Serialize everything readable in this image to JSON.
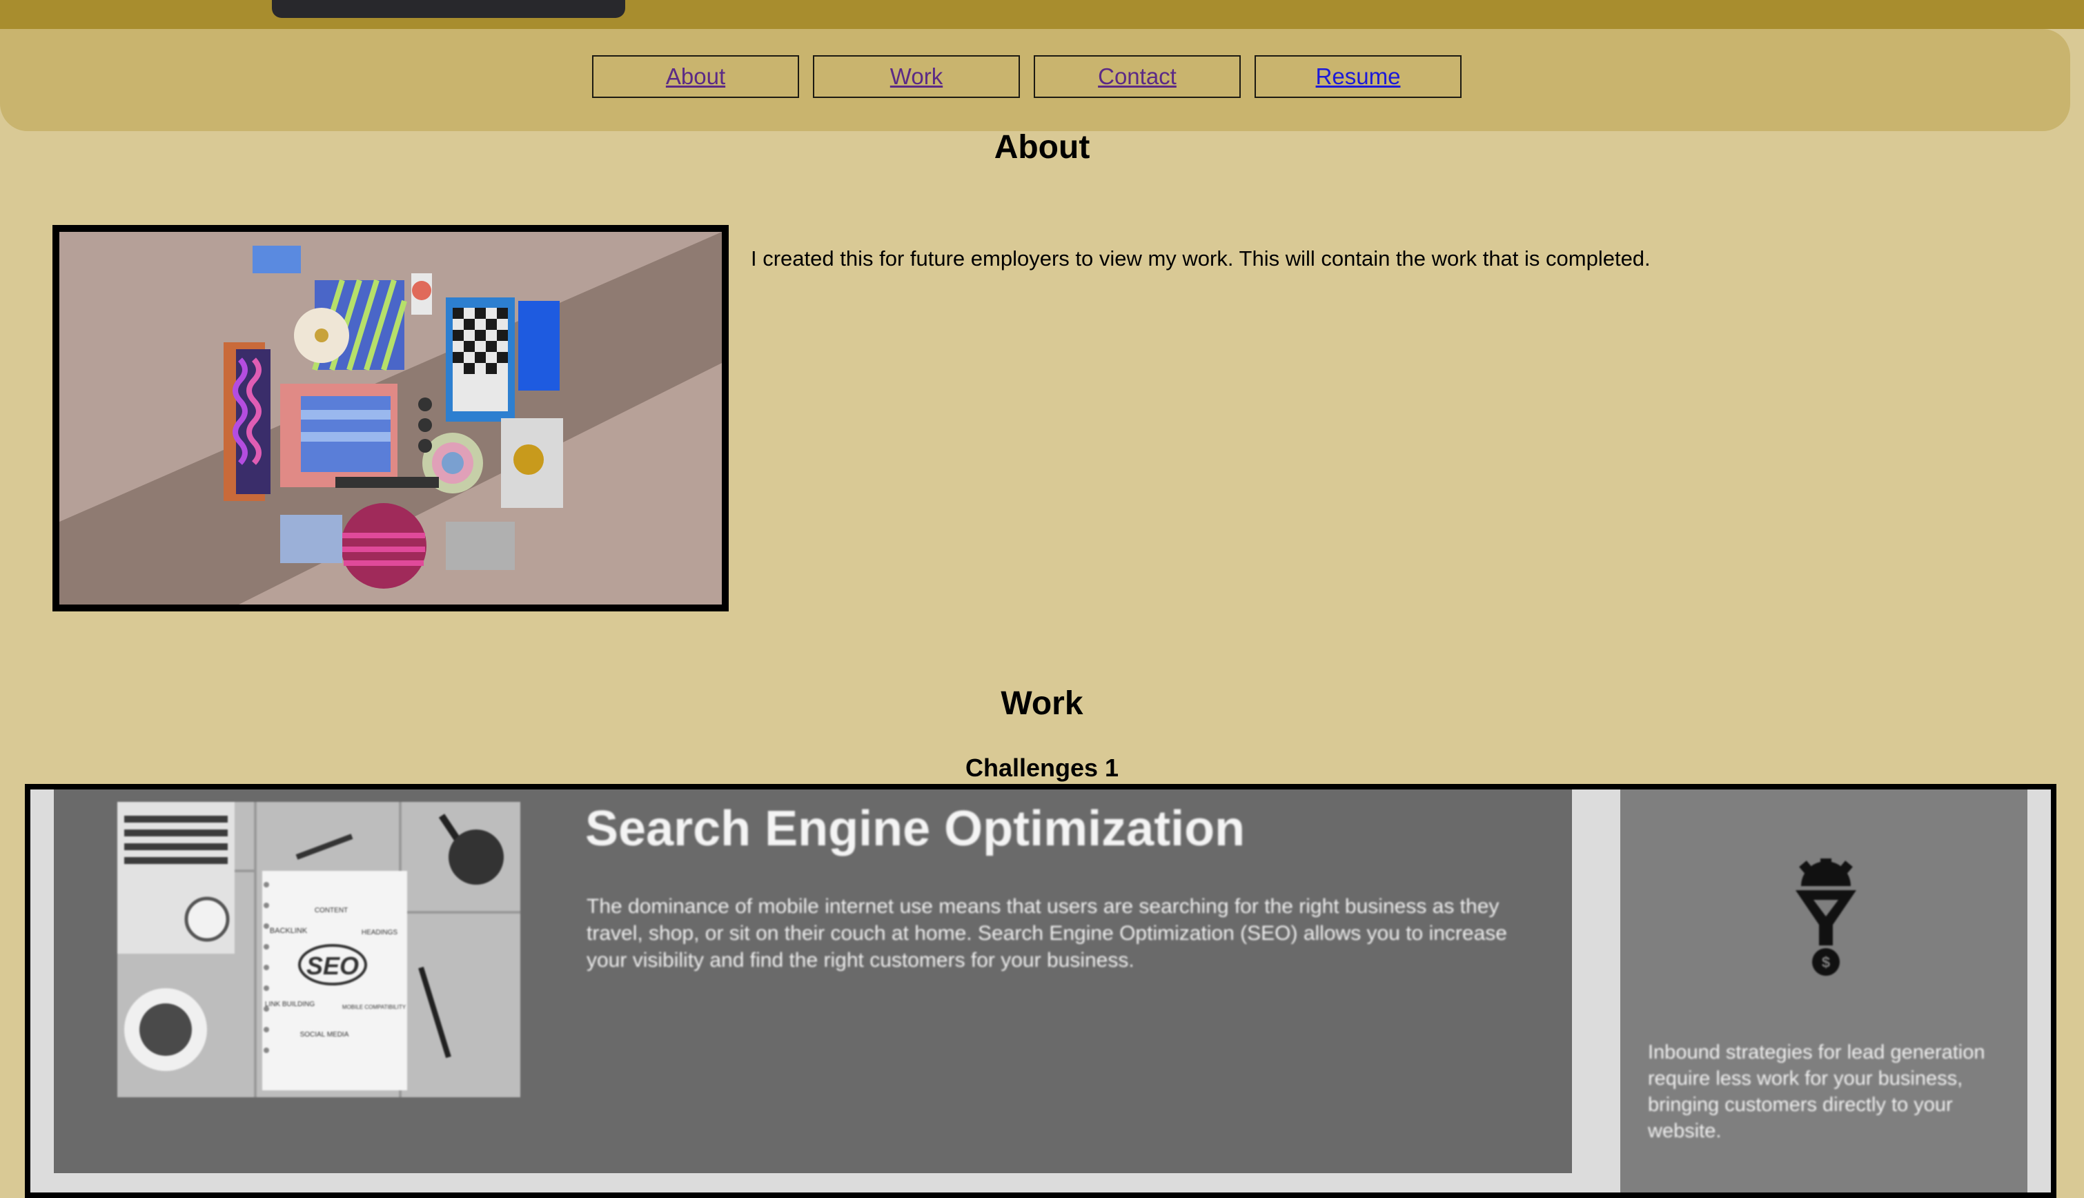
{
  "nav": {
    "items": [
      {
        "label": "About"
      },
      {
        "label": "Work"
      },
      {
        "label": "Contact"
      },
      {
        "label": "Resume"
      }
    ]
  },
  "about": {
    "heading": "About",
    "text": "I created this for future employers to view my work. This will contain the work that is completed."
  },
  "work": {
    "heading": "Work",
    "project_title": "Challenges 1",
    "screenshot": {
      "title": "Search Engine Optimization",
      "description": "The dominance of mobile internet use means that users are searching for the right business as they travel, shop, or sit on their couch at home. Search Engine Optimization (SEO) allows you to increase your visibility and find the right customers for your business.",
      "side_text": "Inbound strategies for lead generation require less work for your business, bringing customers directly to your website.",
      "photo_word": "SEO",
      "photo_labels": [
        "CONTENT",
        "BACKLINK",
        "HEADINGS",
        "LINK BUILDING",
        "MOBILE COMPATIBILITY",
        "SOCIAL MEDIA"
      ],
      "icon": "lead-funnel-icon"
    }
  },
  "colors": {
    "page_bg": "#d9c995",
    "top_strip": "#a88d2e",
    "nav_panel": "#c9b46e",
    "visited_link": "#5b2a86",
    "link": "#1c1ad8"
  }
}
